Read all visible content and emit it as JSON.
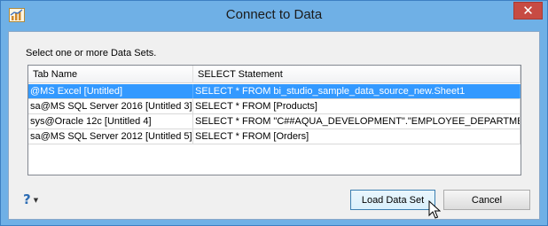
{
  "window": {
    "title": "Connect to Data",
    "close_label": "✕"
  },
  "instruction": "Select one or more Data Sets.",
  "table": {
    "columns": [
      "Tab Name",
      "SELECT Statement"
    ],
    "rows": [
      {
        "tab_name": "@MS Excel [Untitled]",
        "statement": "SELECT * FROM bi_studio_sample_data_source_new.Sheet1",
        "selected": true
      },
      {
        "tab_name": "sa@MS SQL Server 2016 [Untitled 3]",
        "statement": "SELECT * FROM [Products]",
        "selected": false
      },
      {
        "tab_name": "sys@Oracle 12c [Untitled 4]",
        "statement": "SELECT * FROM \"C##AQUA_DEVELOPMENT\".\"EMPLOYEE_DEPARTMENT\"",
        "selected": false
      },
      {
        "tab_name": "sa@MS SQL Server 2012 [Untitled 5]",
        "statement": "SELECT * FROM [Orders]",
        "selected": false
      }
    ]
  },
  "help": {
    "icon": "question-mark-icon",
    "glyph": "?",
    "caret": "▼"
  },
  "buttons": {
    "load": "Load Data Set",
    "cancel": "Cancel"
  },
  "colors": {
    "title_bar": "#6fb0e6",
    "selection": "#3399ff",
    "close_button": "#c74b43"
  }
}
